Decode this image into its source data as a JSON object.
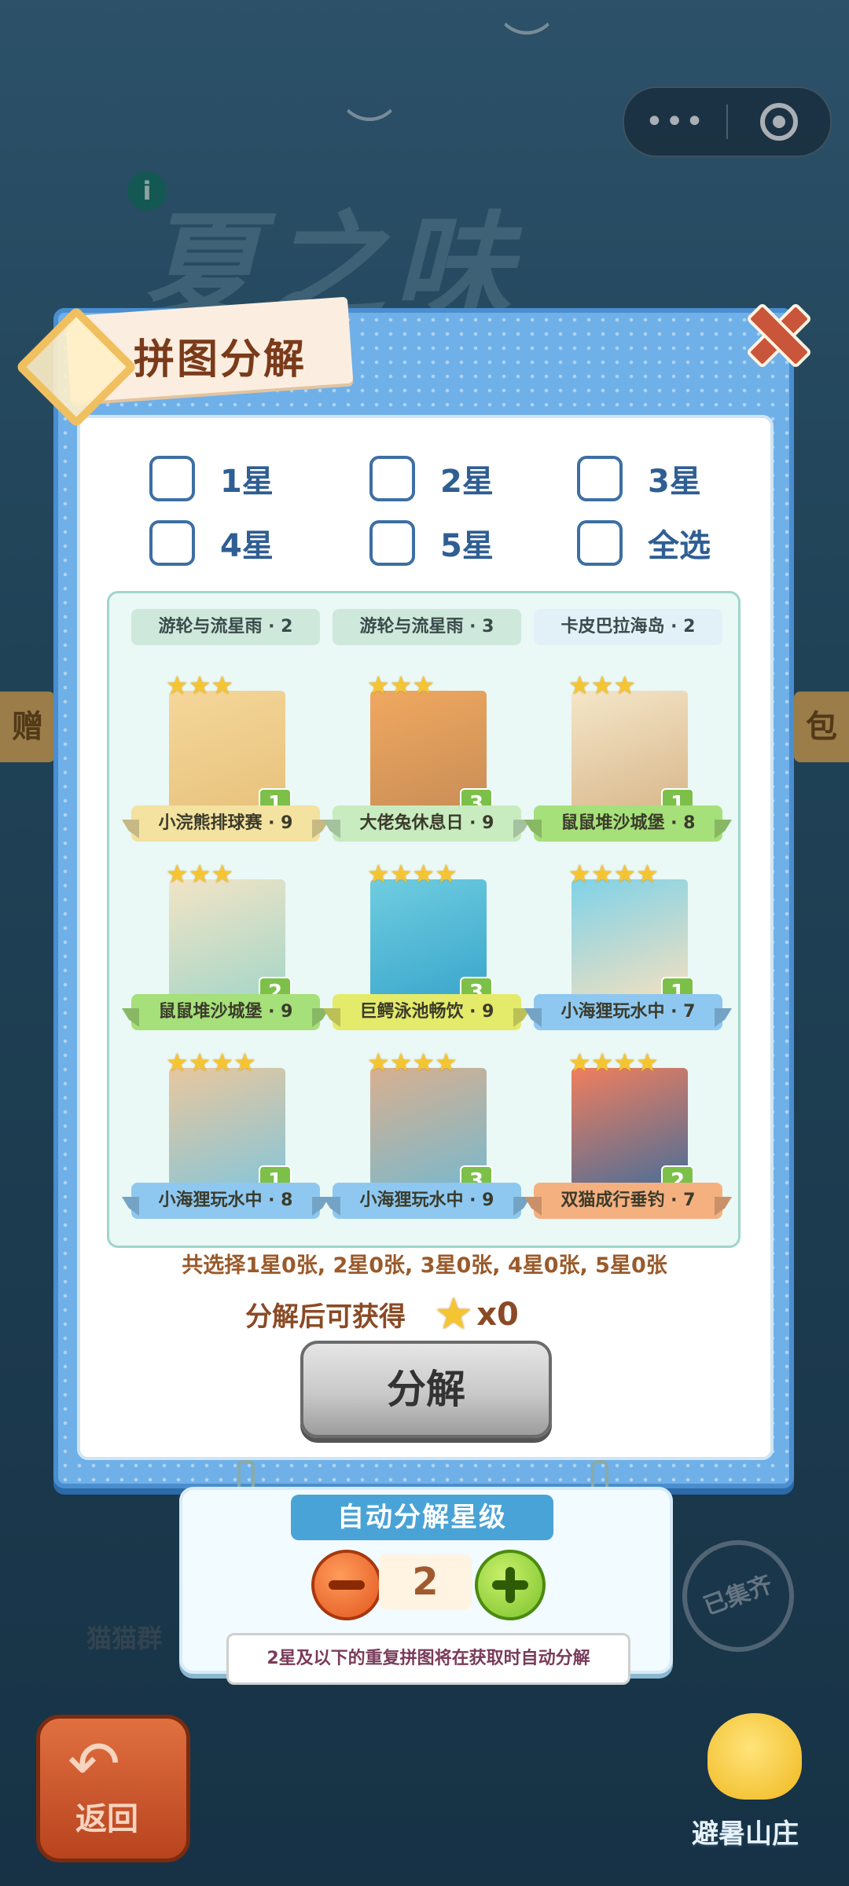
{
  "background": {
    "title": "夏之味",
    "bottom_left_label": "猫猫群",
    "left_side_label": "赠",
    "right_side_label": "包",
    "stamp_label": "已集齐"
  },
  "capsule": {
    "more": "•••"
  },
  "modal": {
    "title": "拼图分解",
    "checkboxes": [
      {
        "label": "1星",
        "checked": false
      },
      {
        "label": "2星",
        "checked": false
      },
      {
        "label": "3星",
        "checked": false
      },
      {
        "label": "4星",
        "checked": false
      },
      {
        "label": "5星",
        "checked": false
      },
      {
        "label": "全选",
        "checked": false
      }
    ],
    "top_row_labels": [
      "游轮与流星雨 · 2",
      "游轮与流星雨 · 3",
      "卡皮巴拉海岛 · 2"
    ],
    "cards": [
      {
        "name": "小浣熊排球赛 · 9",
        "stars": 3,
        "count": "1",
        "ribbon": "#f3e2a0",
        "pic": [
          "#f5d79a",
          "#e7c27c"
        ]
      },
      {
        "name": "大佬兔休息日 · 9",
        "stars": 3,
        "count": "3",
        "ribbon": "#c8ecc0",
        "pic": [
          "#f0a860",
          "#c98e56"
        ]
      },
      {
        "name": "鼠鼠堆沙城堡 · 8",
        "stars": 3,
        "count": "1",
        "ribbon": "#a6e07a",
        "pic": [
          "#f4e6c8",
          "#d9b88c"
        ]
      },
      {
        "name": "鼠鼠堆沙城堡 · 9",
        "stars": 3,
        "count": "2",
        "ribbon": "#a6e07a",
        "pic": [
          "#f2e4c6",
          "#a6d6c8"
        ]
      },
      {
        "name": "巨鳄泳池畅饮 · 9",
        "stars": 4,
        "count": "3",
        "ribbon": "#e4ea6a",
        "pic": [
          "#6fcde0",
          "#3aa6cc"
        ]
      },
      {
        "name": "小海狸玩水中 · 7",
        "stars": 4,
        "count": "1",
        "ribbon": "#8ec8f0",
        "pic": [
          "#7fd2e8",
          "#f2e0c0"
        ]
      },
      {
        "name": "小海狸玩水中 · 8",
        "stars": 4,
        "count": "1",
        "ribbon": "#8ec8f0",
        "pic": [
          "#e8c79e",
          "#88c6d8"
        ]
      },
      {
        "name": "小海狸玩水中 · 9",
        "stars": 4,
        "count": "3",
        "ribbon": "#8ec8f0",
        "pic": [
          "#d8b090",
          "#7ab8cc"
        ]
      },
      {
        "name": "双猫成行垂钓 · 7",
        "stars": 4,
        "count": "2",
        "ribbon": "#f5b080",
        "pic": [
          "#f07e5e",
          "#4a6e98"
        ]
      }
    ],
    "summary": "共选择1星0张, 2星0张, 3星0张, 4星0张, 5星0张",
    "gain_label": "分解后可获得",
    "gain_value": "x0",
    "decompose_button": "分解"
  },
  "auto_panel": {
    "title": "自动分解星级",
    "level": "2",
    "tip": "2星及以下的重复拼图将在获取时自动分解"
  },
  "bottom": {
    "back_label": "返回",
    "right_label": "避暑山庄"
  },
  "colors": {
    "modal_blue": "#6fb0e8",
    "accent_brown": "#7a3b1b",
    "star": "#f5c531"
  }
}
